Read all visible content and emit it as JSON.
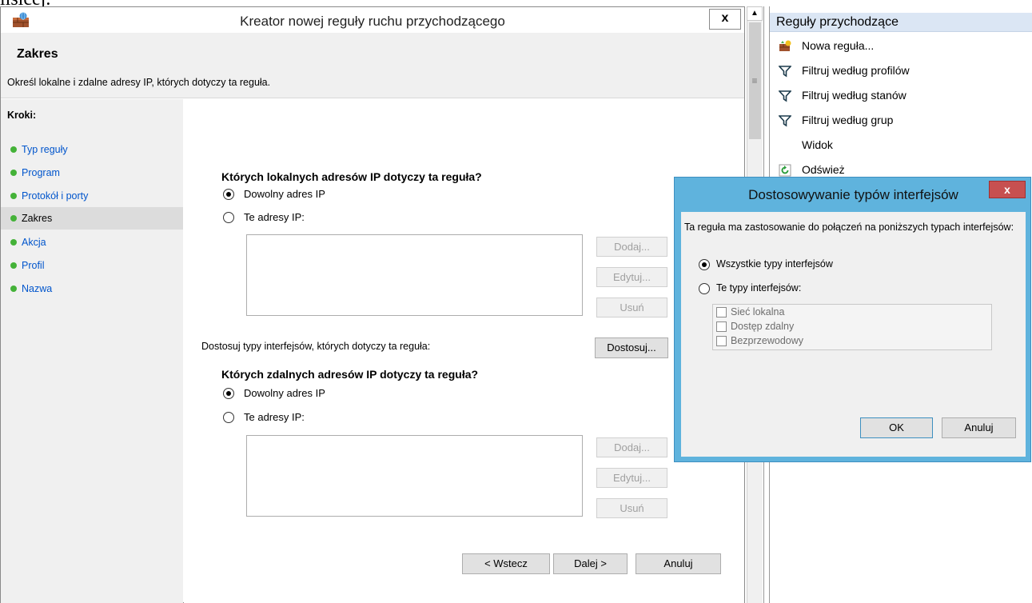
{
  "doc_fragment": "lisicej.",
  "wizard": {
    "title": "Kreator nowej reguły ruchu przychodzącego",
    "close_label": "x",
    "header_title": "Zakres",
    "header_desc": "Określ lokalne i zdalne adresy IP, których dotyczy ta reguła.",
    "steps_title": "Kroki:",
    "steps": [
      {
        "label": "Typ reguły",
        "active": false
      },
      {
        "label": "Program",
        "active": false
      },
      {
        "label": "Protokół i porty",
        "active": false
      },
      {
        "label": "Zakres",
        "active": true
      },
      {
        "label": "Akcja",
        "active": false
      },
      {
        "label": "Profil",
        "active": false
      },
      {
        "label": "Nazwa",
        "active": false
      }
    ],
    "local": {
      "question": "Których lokalnych adresów IP dotyczy ta reguła?",
      "opt_any": "Dowolny adres IP",
      "opt_these": "Te adresy IP:",
      "selected": "any",
      "btn_add": "Dodaj...",
      "btn_edit": "Edytuj...",
      "btn_remove": "Usuń"
    },
    "interfaces_label": "Dostosuj typy interfejsów, których dotyczy ta reguła:",
    "customize_btn": "Dostosuj...",
    "remote": {
      "question": "Których zdalnych adresów IP dotyczy ta reguła?",
      "opt_any": "Dowolny adres IP",
      "opt_these": "Te adresy IP:",
      "selected": "any",
      "btn_add": "Dodaj...",
      "btn_edit": "Edytuj...",
      "btn_remove": "Usuń"
    },
    "nav": {
      "back": "< Wstecz",
      "next": "Dalej >",
      "cancel": "Anuluj"
    }
  },
  "actions": {
    "header": "Reguły przychodzące",
    "items": [
      {
        "label": "Nowa reguła...",
        "icon": "new-rule-icon"
      },
      {
        "label": "Filtruj według profilów",
        "icon": "filter-icon"
      },
      {
        "label": "Filtruj według stanów",
        "icon": "filter-icon"
      },
      {
        "label": "Filtruj według grup",
        "icon": "filter-icon"
      },
      {
        "label": "Widok",
        "icon": ""
      },
      {
        "label": "Odśwież",
        "icon": "refresh-icon"
      }
    ]
  },
  "dialog": {
    "title": "Dostosowywanie typów interfejsów",
    "close_label": "x",
    "desc": "Ta reguła ma zastosowanie do połączeń na poniższych typach interfejsów:",
    "opt_all": "Wszystkie typy interfejsów",
    "opt_these": "Te typy interfejsów:",
    "selected": "all",
    "types": [
      "Sieć lokalna",
      "Dostęp zdalny",
      "Bezprzewodowy"
    ],
    "ok": "OK",
    "cancel": "Anuluj"
  },
  "colors": {
    "accent_title": "#5fb3dd",
    "step_link": "#0055cc",
    "step_dot": "#44b238",
    "actions_header_bg": "#dbe6f4"
  }
}
